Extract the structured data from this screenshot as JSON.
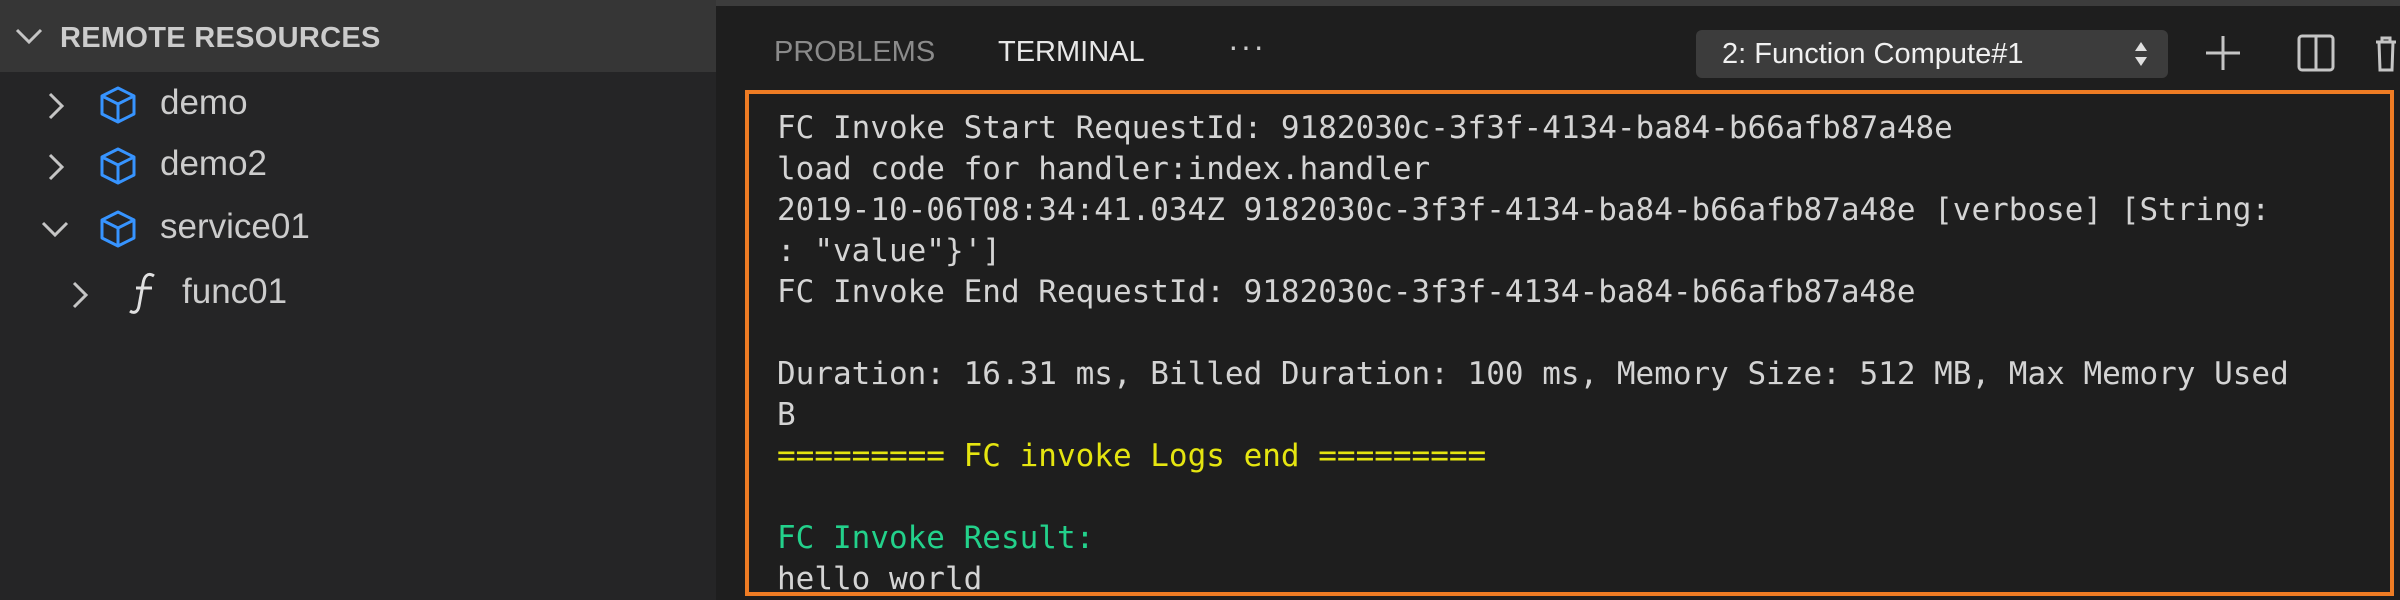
{
  "sidebar": {
    "header_title": "REMOTE RESOURCES",
    "items": [
      {
        "label": "demo",
        "expanded": false,
        "icon": "cube-icon"
      },
      {
        "label": "demo2",
        "expanded": false,
        "icon": "cube-icon"
      },
      {
        "label": "service01",
        "expanded": true,
        "icon": "cube-icon"
      },
      {
        "label": "func01",
        "expanded": false,
        "icon": "function-icon"
      }
    ]
  },
  "panel": {
    "tabs": [
      {
        "label": "PROBLEMS",
        "active": false
      },
      {
        "label": "TERMINAL",
        "active": true
      }
    ],
    "more_label": "···",
    "terminal_select": {
      "value": "2: Function Compute#1"
    }
  },
  "terminal": {
    "lines": [
      "FC Invoke Start RequestId: 9182030c-3f3f-4134-ba84-b66afb87a48e",
      "load code for handler:index.handler",
      "2019-10-06T08:34:41.034Z 9182030c-3f3f-4134-ba84-b66afb87a48e [verbose] [String:",
      ": \"value\"}']",
      "FC Invoke End RequestId: 9182030c-3f3f-4134-ba84-b66afb87a48e",
      "Duration: 16.31 ms, Billed Duration: 100 ms, Memory Size: 512 MB, Max Memory Used",
      "B",
      "========= FC invoke Logs end =========",
      "FC Invoke Result:",
      "hello world"
    ]
  },
  "colors": {
    "accent_border": "#ee7c24",
    "log_end_yellow": "#e5e510",
    "result_green": "#23d18b",
    "cube_blue": "#3794ff"
  }
}
